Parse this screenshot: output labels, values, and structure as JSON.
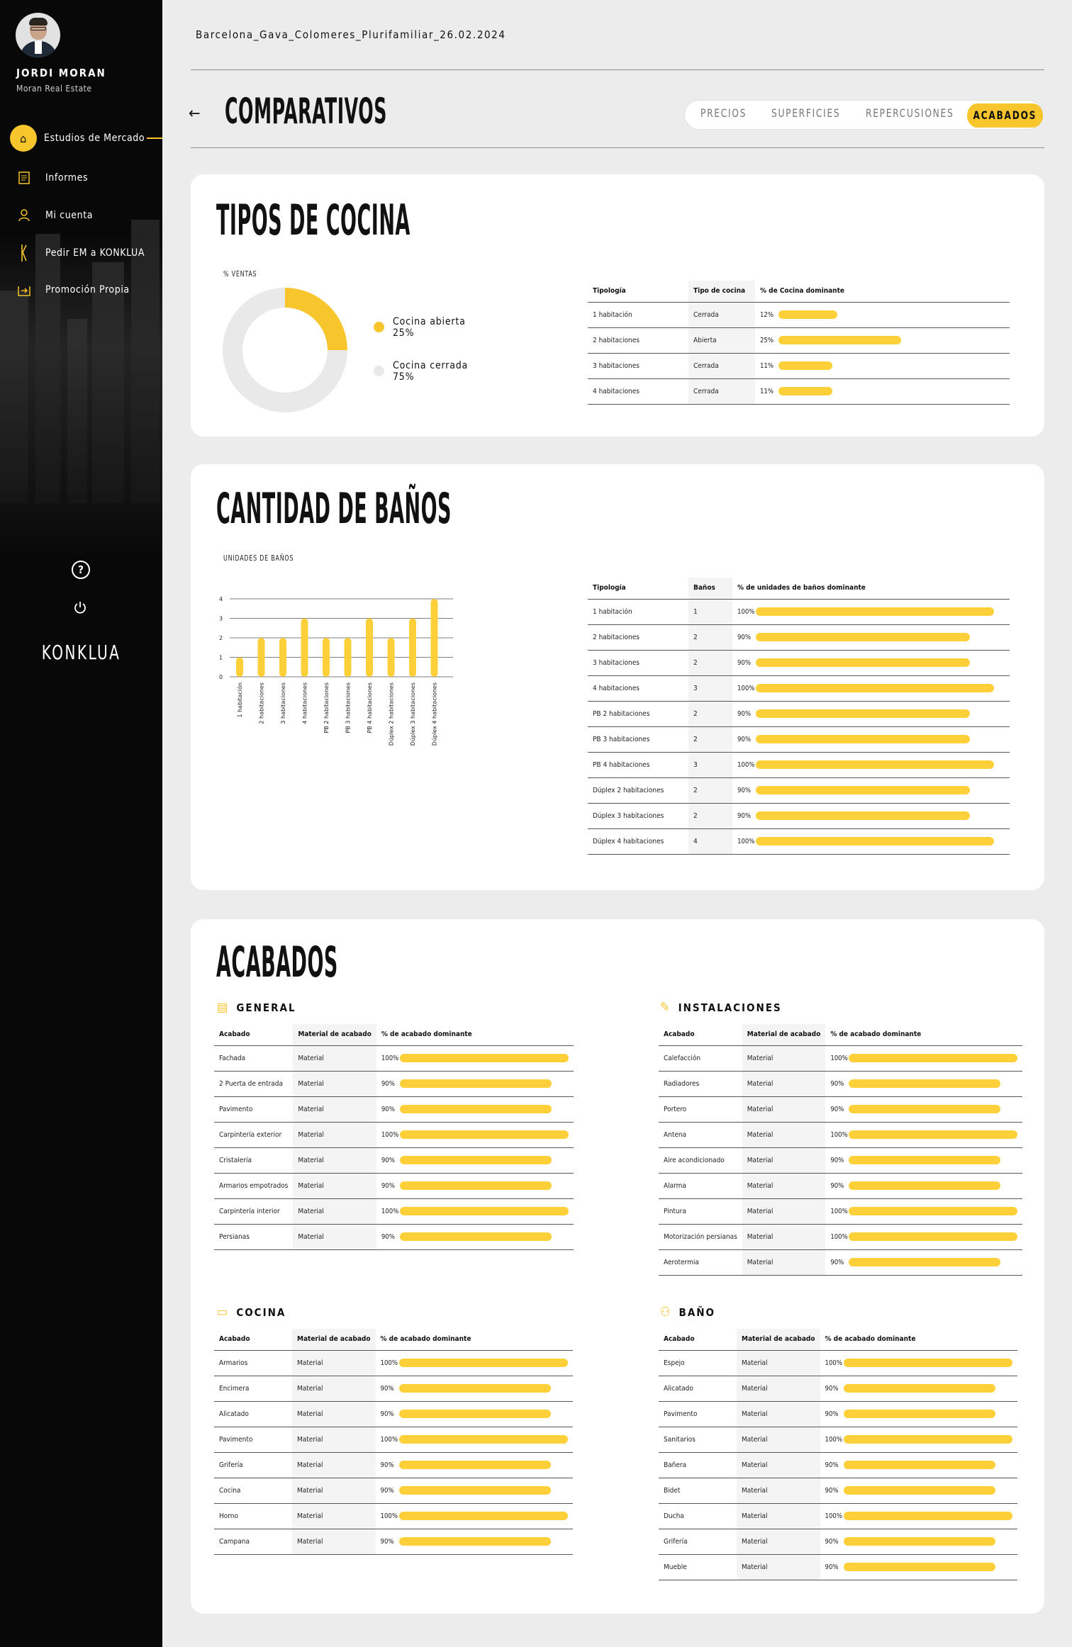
{
  "user": {
    "name": "JORDI MORAN",
    "company": "Moran Real Estate"
  },
  "nav": [
    {
      "label": "Estudios de Mercado",
      "icon": "house-euro-icon",
      "active": true
    },
    {
      "label": "Informes",
      "icon": "document-icon"
    },
    {
      "label": "Mi cuenta",
      "icon": "user-icon"
    },
    {
      "label": "Pedir EM a KONKLUA",
      "icon": "konklua-k-icon"
    },
    {
      "label": "Promoción Propia",
      "icon": "export-icon"
    }
  ],
  "help_icon": "?",
  "brand": "KONKLUA",
  "file_title": "Barcelona_Gava_Colomeres_Plurifamiliar_26.02.2024",
  "page_title": "COMPARATIVOS",
  "tabs": [
    "PRECIOS",
    "SUPERFICIES",
    "REPERCUSIONES",
    "ACABADOS"
  ],
  "active_tab": "ACABADOS",
  "accent_color": "#f7c52c",
  "cocina": {
    "title": "TIPOS DE COCINA",
    "chart_label": "% VENTAS",
    "legend": [
      {
        "name": "Cocina abierta",
        "value": "25%",
        "color": "#f7c52c"
      },
      {
        "name": "Cocina cerrada",
        "value": "75%",
        "color": "#e9e9e9"
      }
    ],
    "table": {
      "headers": [
        "Tipología",
        "Tipo de cocina",
        "% de Cocina dominante"
      ],
      "rows": [
        {
          "tipologia": "1 habitación",
          "tipo": "Cerrada",
          "pct": "12%",
          "frac": 0.12
        },
        {
          "tipologia": "2 habitaciones",
          "tipo": "Abierta",
          "pct": "25%",
          "frac": 0.25
        },
        {
          "tipologia": "3 habitaciones",
          "tipo": "Cerrada",
          "pct": "11%",
          "frac": 0.11
        },
        {
          "tipologia": "4 habitaciones",
          "tipo": "Cerrada",
          "pct": "11%",
          "frac": 0.11
        }
      ]
    }
  },
  "chart_data": [
    {
      "type": "pie",
      "title": "% VENTAS",
      "categories": [
        "Cocina abierta",
        "Cocina cerrada"
      ],
      "values": [
        25,
        75
      ]
    },
    {
      "type": "bar",
      "title": "UNIDADES DE BAÑOS",
      "categories": [
        "1 habitación",
        "2 habitaciones",
        "3 habitaciones",
        "4 habitaciones",
        "PB 2 habitaciones",
        "PB 3 habitaciones",
        "PB 4 habitaciones",
        "Dúplex 2 habitaciones",
        "Dúplex 3 habitaciones",
        "Dúplex 4 habitaciones"
      ],
      "values": [
        1,
        2,
        2,
        3,
        2,
        2,
        3,
        2,
        3,
        4
      ],
      "ylim": [
        0,
        4
      ],
      "yticks": [
        "0",
        "1",
        "2",
        "3",
        "4"
      ],
      "grid": true
    }
  ],
  "banos": {
    "title": "CANTIDAD DE BAÑOS",
    "chart_label": "UNIDADES DE BAÑOS",
    "table": {
      "headers": [
        "Tipología",
        "Baños",
        "% de unidades de baños dominante"
      ],
      "rows": [
        {
          "tipologia": "1 habitación",
          "banos": "1",
          "pct": "100%",
          "frac": 1.0
        },
        {
          "tipologia": "2 habitaciones",
          "banos": "2",
          "pct": "90%",
          "frac": 0.9
        },
        {
          "tipologia": "3 habitaciones",
          "banos": "2",
          "pct": "90%",
          "frac": 0.9
        },
        {
          "tipologia": "4 habitaciones",
          "banos": "3",
          "pct": "100%",
          "frac": 1.0
        },
        {
          "tipologia": "PB 2 habitaciones",
          "banos": "2",
          "pct": "90%",
          "frac": 0.9
        },
        {
          "tipologia": "PB 3 habitaciones",
          "banos": "2",
          "pct": "90%",
          "frac": 0.9
        },
        {
          "tipologia": "PB 4 habitaciones",
          "banos": "3",
          "pct": "100%",
          "frac": 1.0
        },
        {
          "tipologia": "Dúplex 2 habitaciones",
          "banos": "2",
          "pct": "90%",
          "frac": 0.9
        },
        {
          "tipologia": "Dúplex 3 habitaciones",
          "banos": "2",
          "pct": "90%",
          "frac": 0.9
        },
        {
          "tipologia": "Dúplex 4 habitaciones",
          "banos": "4",
          "pct": "100%",
          "frac": 1.0
        }
      ]
    }
  },
  "acabados": {
    "title": "ACABADOS",
    "headers": [
      "Acabado",
      "Material de acabado",
      "% de acabado dominante"
    ],
    "sections": [
      {
        "key": "general",
        "title": "GENERAL",
        "icon": "building-icon",
        "rows": [
          {
            "acabado": "Fachada",
            "material": "Material",
            "pct": "100%",
            "frac": 1.0
          },
          {
            "acabado": "2 Puerta de entrada",
            "material": "Material",
            "pct": "90%",
            "frac": 0.9
          },
          {
            "acabado": "Pavimento",
            "material": "Material",
            "pct": "90%",
            "frac": 0.9
          },
          {
            "acabado": "Carpintería exterior",
            "material": "Material",
            "pct": "100%",
            "frac": 1.0
          },
          {
            "acabado": "Cristalería",
            "material": "Material",
            "pct": "90%",
            "frac": 0.9
          },
          {
            "acabado": "Armarios empotrados",
            "material": "Material",
            "pct": "90%",
            "frac": 0.9
          },
          {
            "acabado": "Carpintería interior",
            "material": "Material",
            "pct": "100%",
            "frac": 1.0
          },
          {
            "acabado": "Persianas",
            "material": "Material",
            "pct": "90%",
            "frac": 0.9
          }
        ]
      },
      {
        "key": "instalaciones",
        "title": "INSTALACIONES",
        "icon": "tools-icon",
        "rows": [
          {
            "acabado": "Calefacción",
            "material": "Material",
            "pct": "100%",
            "frac": 1.0
          },
          {
            "acabado": "Radiadores",
            "material": "Material",
            "pct": "90%",
            "frac": 0.9
          },
          {
            "acabado": "Portero",
            "material": "Material",
            "pct": "90%",
            "frac": 0.9
          },
          {
            "acabado": "Antena",
            "material": "Material",
            "pct": "100%",
            "frac": 1.0
          },
          {
            "acabado": "Aire acondicionado",
            "material": "Material",
            "pct": "90%",
            "frac": 0.9
          },
          {
            "acabado": "Alarma",
            "material": "Material",
            "pct": "90%",
            "frac": 0.9
          },
          {
            "acabado": "Pintura",
            "material": "Material",
            "pct": "100%",
            "frac": 1.0
          },
          {
            "acabado": "Motorización persianas",
            "material": "Material",
            "pct": "100%",
            "frac": 1.0
          },
          {
            "acabado": "Aerotermia",
            "material": "Material",
            "pct": "90%",
            "frac": 0.9
          }
        ]
      },
      {
        "key": "cocina",
        "title": "COCINA",
        "icon": "oven-icon",
        "rows": [
          {
            "acabado": "Armarios",
            "material": "Material",
            "pct": "100%",
            "frac": 1.0
          },
          {
            "acabado": "Encimera",
            "material": "Material",
            "pct": "90%",
            "frac": 0.9
          },
          {
            "acabado": "Alicatado",
            "material": "Material",
            "pct": "90%",
            "frac": 0.9
          },
          {
            "acabado": "Pavimento",
            "material": "Material",
            "pct": "100%",
            "frac": 1.0
          },
          {
            "acabado": "Grifería",
            "material": "Material",
            "pct": "90%",
            "frac": 0.9
          },
          {
            "acabado": "Cocina",
            "material": "Material",
            "pct": "90%",
            "frac": 0.9
          },
          {
            "acabado": "Horno",
            "material": "Material",
            "pct": "100%",
            "frac": 1.0
          },
          {
            "acabado": "Campana",
            "material": "Material",
            "pct": "90%",
            "frac": 0.9
          }
        ]
      },
      {
        "key": "bano",
        "title": "BAÑO",
        "icon": "people-icon",
        "rows": [
          {
            "acabado": "Espejo",
            "material": "Material",
            "pct": "100%",
            "frac": 1.0
          },
          {
            "acabado": "Alicatado",
            "material": "Material",
            "pct": "90%",
            "frac": 0.9
          },
          {
            "acabado": "Pavimento",
            "material": "Material",
            "pct": "90%",
            "frac": 0.9
          },
          {
            "acabado": "Sanitarios",
            "material": "Material",
            "pct": "100%",
            "frac": 1.0
          },
          {
            "acabado": "Bañera",
            "material": "Material",
            "pct": "90%",
            "frac": 0.9
          },
          {
            "acabado": "Bidet",
            "material": "Material",
            "pct": "90%",
            "frac": 0.9
          },
          {
            "acabado": "Ducha",
            "material": "Material",
            "pct": "100%",
            "frac": 1.0
          },
          {
            "acabado": "Grifería",
            "material": "Material",
            "pct": "90%",
            "frac": 0.9
          },
          {
            "acabado": "Mueble",
            "material": "Material",
            "pct": "90%",
            "frac": 0.9
          }
        ]
      }
    ]
  }
}
